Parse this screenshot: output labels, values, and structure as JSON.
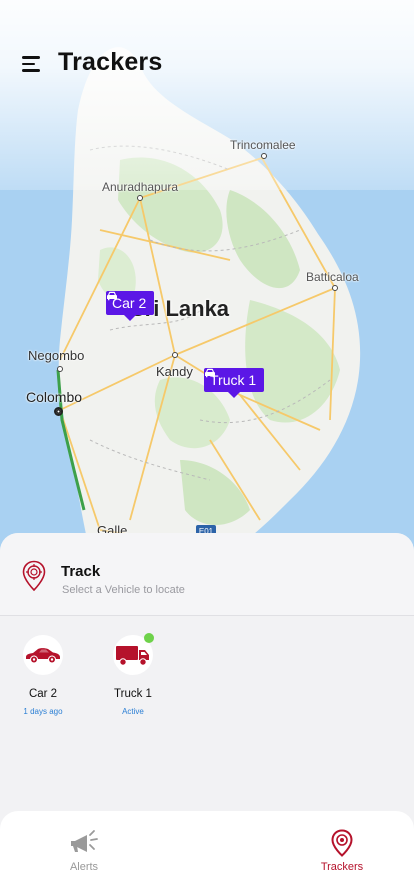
{
  "header": {
    "title": "Trackers",
    "menu_icon": "hamburger-menu-icon"
  },
  "map": {
    "country_label": "Sri Lanka",
    "cities": [
      "Trincomalee",
      "Anuradhapura",
      "Batticaloa",
      "Negombo",
      "Kandy",
      "Colombo",
      "Galle"
    ],
    "road_shield": "E01",
    "markers": [
      {
        "label": "Car 2",
        "icon": "car-icon"
      },
      {
        "label": "Truck 1",
        "icon": "car-icon"
      }
    ]
  },
  "track": {
    "title": "Track",
    "subtitle": "Select a Vehicle to locate",
    "icon": "location-target-pin-icon"
  },
  "vehicles": [
    {
      "name": "Car 2",
      "status": "1 days ago",
      "icon": "car-icon",
      "online": false
    },
    {
      "name": "Truck 1",
      "status": "Active",
      "icon": "truck-icon",
      "online": true
    }
  ],
  "tabs": [
    {
      "label": "Alerts",
      "icon": "megaphone-icon",
      "active": false
    },
    {
      "label": "Trackers",
      "icon": "location-pin-icon",
      "active": true
    }
  ],
  "colors": {
    "accent": "#b5122b",
    "marker": "#5b17e6",
    "status_link": "#2b7fd4",
    "online_dot": "#6ed24a",
    "inactive_tab": "#999999"
  }
}
